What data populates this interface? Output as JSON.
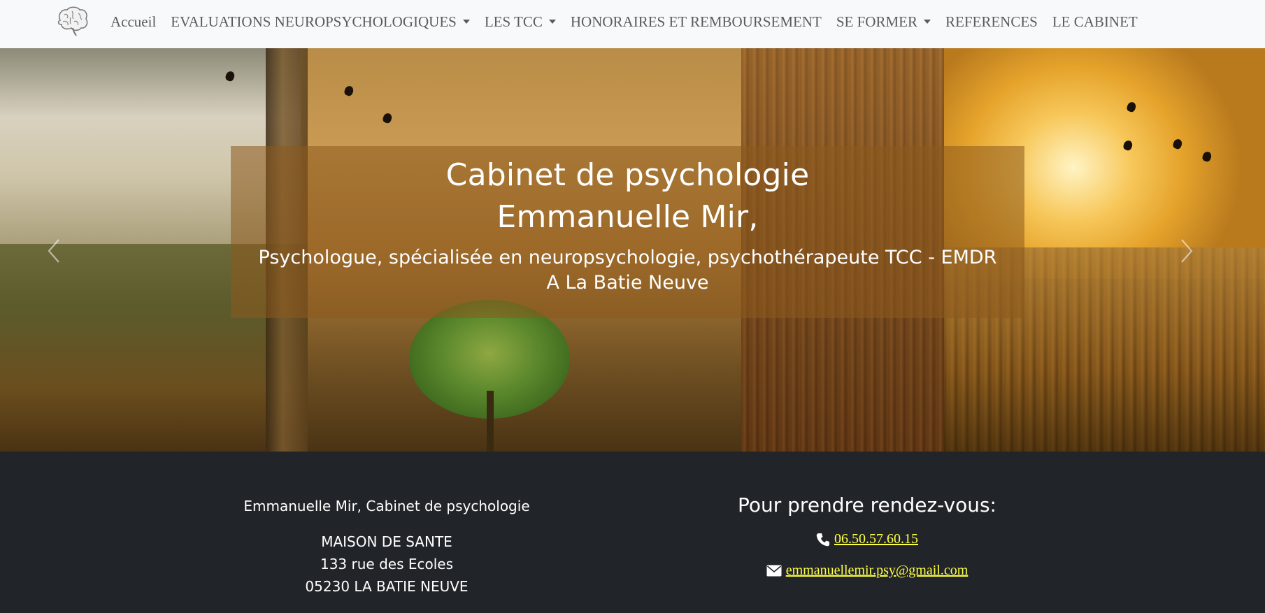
{
  "nav": {
    "logo_icon": "brain-logo-icon",
    "items": [
      {
        "label": "Accueil",
        "dropdown": false
      },
      {
        "label": "EVALUATIONS NEUROPSYCHOLOGIQUES",
        "dropdown": true
      },
      {
        "label": "LES TCC",
        "dropdown": true
      },
      {
        "label": "HONORAIRES ET REMBOURSEMENT",
        "dropdown": false
      },
      {
        "label": "SE FORMER",
        "dropdown": true
      },
      {
        "label": "REFERENCES",
        "dropdown": false
      },
      {
        "label": "LE CABINET",
        "dropdown": false
      }
    ]
  },
  "hero": {
    "title_line1": "Cabinet de psychologie",
    "title_line2": "Emmanuelle Mir,",
    "subtitle_line1": "Psychologue, spécialisée en neuropsychologie, psychothérapeute TCC - EMDR",
    "subtitle_line2": "A La Batie Neuve",
    "prev_icon": "chevron-left-icon",
    "next_icon": "chevron-right-icon"
  },
  "footer": {
    "name": "Emmanuelle Mir, Cabinet de psychologie",
    "address_line1": "MAISON DE SANTE",
    "address_line2": "133 rue des Ecoles",
    "address_line3": "05230 LA BATIE NEUVE",
    "rdv_title": "Pour prendre rendez-vous:",
    "phone": "06.50.57.60.15",
    "phone_icon": "phone-icon",
    "email": "emmanuellemir.psy@gmail.com",
    "email_icon": "envelope-icon"
  },
  "colors": {
    "navbar_bg": "#f8f9fa",
    "nav_text": "#5b5b5b",
    "footer_bg": "#212529",
    "link": "#ffff44"
  }
}
